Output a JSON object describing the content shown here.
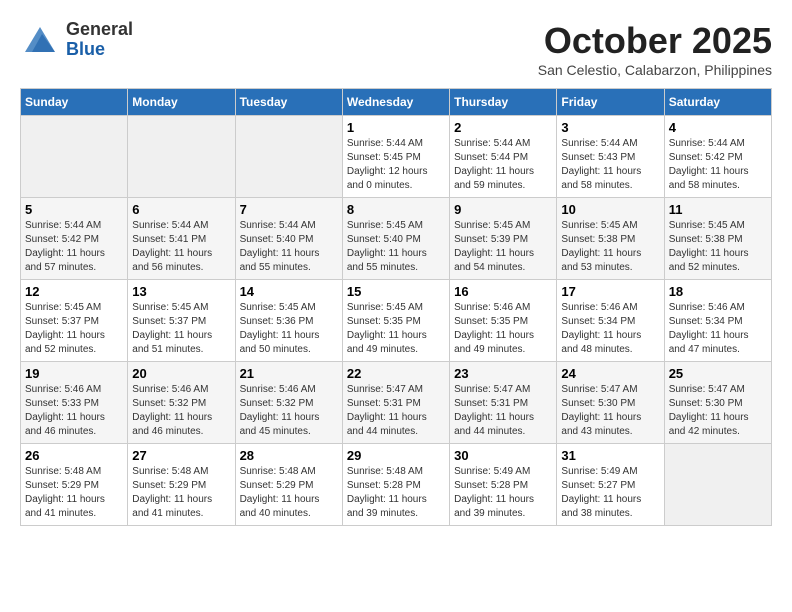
{
  "header": {
    "logo_general": "General",
    "logo_blue": "Blue",
    "month_title": "October 2025",
    "subtitle": "San Celestio, Calabarzon, Philippines"
  },
  "weekdays": [
    "Sunday",
    "Monday",
    "Tuesday",
    "Wednesday",
    "Thursday",
    "Friday",
    "Saturday"
  ],
  "weeks": [
    [
      {
        "day": "",
        "sunrise": "",
        "sunset": "",
        "daylight": "",
        "empty": true
      },
      {
        "day": "",
        "sunrise": "",
        "sunset": "",
        "daylight": "",
        "empty": true
      },
      {
        "day": "",
        "sunrise": "",
        "sunset": "",
        "daylight": "",
        "empty": true
      },
      {
        "day": "1",
        "sunrise": "Sunrise: 5:44 AM",
        "sunset": "Sunset: 5:45 PM",
        "daylight": "Daylight: 12 hours and 0 minutes."
      },
      {
        "day": "2",
        "sunrise": "Sunrise: 5:44 AM",
        "sunset": "Sunset: 5:44 PM",
        "daylight": "Daylight: 11 hours and 59 minutes."
      },
      {
        "day": "3",
        "sunrise": "Sunrise: 5:44 AM",
        "sunset": "Sunset: 5:43 PM",
        "daylight": "Daylight: 11 hours and 58 minutes."
      },
      {
        "day": "4",
        "sunrise": "Sunrise: 5:44 AM",
        "sunset": "Sunset: 5:42 PM",
        "daylight": "Daylight: 11 hours and 58 minutes."
      }
    ],
    [
      {
        "day": "5",
        "sunrise": "Sunrise: 5:44 AM",
        "sunset": "Sunset: 5:42 PM",
        "daylight": "Daylight: 11 hours and 57 minutes."
      },
      {
        "day": "6",
        "sunrise": "Sunrise: 5:44 AM",
        "sunset": "Sunset: 5:41 PM",
        "daylight": "Daylight: 11 hours and 56 minutes."
      },
      {
        "day": "7",
        "sunrise": "Sunrise: 5:44 AM",
        "sunset": "Sunset: 5:40 PM",
        "daylight": "Daylight: 11 hours and 55 minutes."
      },
      {
        "day": "8",
        "sunrise": "Sunrise: 5:45 AM",
        "sunset": "Sunset: 5:40 PM",
        "daylight": "Daylight: 11 hours and 55 minutes."
      },
      {
        "day": "9",
        "sunrise": "Sunrise: 5:45 AM",
        "sunset": "Sunset: 5:39 PM",
        "daylight": "Daylight: 11 hours and 54 minutes."
      },
      {
        "day": "10",
        "sunrise": "Sunrise: 5:45 AM",
        "sunset": "Sunset: 5:38 PM",
        "daylight": "Daylight: 11 hours and 53 minutes."
      },
      {
        "day": "11",
        "sunrise": "Sunrise: 5:45 AM",
        "sunset": "Sunset: 5:38 PM",
        "daylight": "Daylight: 11 hours and 52 minutes."
      }
    ],
    [
      {
        "day": "12",
        "sunrise": "Sunrise: 5:45 AM",
        "sunset": "Sunset: 5:37 PM",
        "daylight": "Daylight: 11 hours and 52 minutes."
      },
      {
        "day": "13",
        "sunrise": "Sunrise: 5:45 AM",
        "sunset": "Sunset: 5:37 PM",
        "daylight": "Daylight: 11 hours and 51 minutes."
      },
      {
        "day": "14",
        "sunrise": "Sunrise: 5:45 AM",
        "sunset": "Sunset: 5:36 PM",
        "daylight": "Daylight: 11 hours and 50 minutes."
      },
      {
        "day": "15",
        "sunrise": "Sunrise: 5:45 AM",
        "sunset": "Sunset: 5:35 PM",
        "daylight": "Daylight: 11 hours and 49 minutes."
      },
      {
        "day": "16",
        "sunrise": "Sunrise: 5:46 AM",
        "sunset": "Sunset: 5:35 PM",
        "daylight": "Daylight: 11 hours and 49 minutes."
      },
      {
        "day": "17",
        "sunrise": "Sunrise: 5:46 AM",
        "sunset": "Sunset: 5:34 PM",
        "daylight": "Daylight: 11 hours and 48 minutes."
      },
      {
        "day": "18",
        "sunrise": "Sunrise: 5:46 AM",
        "sunset": "Sunset: 5:34 PM",
        "daylight": "Daylight: 11 hours and 47 minutes."
      }
    ],
    [
      {
        "day": "19",
        "sunrise": "Sunrise: 5:46 AM",
        "sunset": "Sunset: 5:33 PM",
        "daylight": "Daylight: 11 hours and 46 minutes."
      },
      {
        "day": "20",
        "sunrise": "Sunrise: 5:46 AM",
        "sunset": "Sunset: 5:32 PM",
        "daylight": "Daylight: 11 hours and 46 minutes."
      },
      {
        "day": "21",
        "sunrise": "Sunrise: 5:46 AM",
        "sunset": "Sunset: 5:32 PM",
        "daylight": "Daylight: 11 hours and 45 minutes."
      },
      {
        "day": "22",
        "sunrise": "Sunrise: 5:47 AM",
        "sunset": "Sunset: 5:31 PM",
        "daylight": "Daylight: 11 hours and 44 minutes."
      },
      {
        "day": "23",
        "sunrise": "Sunrise: 5:47 AM",
        "sunset": "Sunset: 5:31 PM",
        "daylight": "Daylight: 11 hours and 44 minutes."
      },
      {
        "day": "24",
        "sunrise": "Sunrise: 5:47 AM",
        "sunset": "Sunset: 5:30 PM",
        "daylight": "Daylight: 11 hours and 43 minutes."
      },
      {
        "day": "25",
        "sunrise": "Sunrise: 5:47 AM",
        "sunset": "Sunset: 5:30 PM",
        "daylight": "Daylight: 11 hours and 42 minutes."
      }
    ],
    [
      {
        "day": "26",
        "sunrise": "Sunrise: 5:48 AM",
        "sunset": "Sunset: 5:29 PM",
        "daylight": "Daylight: 11 hours and 41 minutes."
      },
      {
        "day": "27",
        "sunrise": "Sunrise: 5:48 AM",
        "sunset": "Sunset: 5:29 PM",
        "daylight": "Daylight: 11 hours and 41 minutes."
      },
      {
        "day": "28",
        "sunrise": "Sunrise: 5:48 AM",
        "sunset": "Sunset: 5:29 PM",
        "daylight": "Daylight: 11 hours and 40 minutes."
      },
      {
        "day": "29",
        "sunrise": "Sunrise: 5:48 AM",
        "sunset": "Sunset: 5:28 PM",
        "daylight": "Daylight: 11 hours and 39 minutes."
      },
      {
        "day": "30",
        "sunrise": "Sunrise: 5:49 AM",
        "sunset": "Sunset: 5:28 PM",
        "daylight": "Daylight: 11 hours and 39 minutes."
      },
      {
        "day": "31",
        "sunrise": "Sunrise: 5:49 AM",
        "sunset": "Sunset: 5:27 PM",
        "daylight": "Daylight: 11 hours and 38 minutes."
      },
      {
        "day": "",
        "sunrise": "",
        "sunset": "",
        "daylight": "",
        "empty": true
      }
    ]
  ]
}
